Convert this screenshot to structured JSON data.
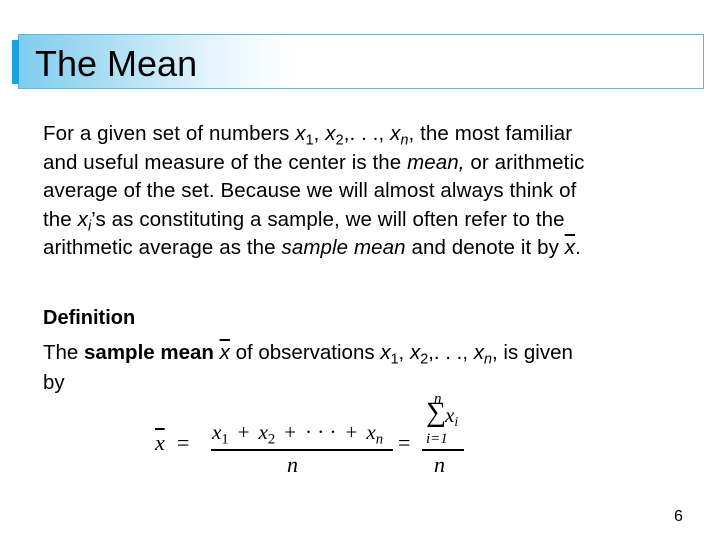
{
  "slide": {
    "title": "The Mean",
    "page_number": "6"
  },
  "intro": {
    "line1_a": "For a given set of numbers ",
    "line1_b": ", the most familiar",
    "line2_a": "and useful measure of the center is the ",
    "line2_em": "mean,",
    "line2_b": " or arithmetic",
    "line3": "average of the set. Because we will almost always think of",
    "line4_a": "the ",
    "line4_b": "’s as constituting a sample, we will often refer to the",
    "line5_a": "arithmetic average as the ",
    "line5_em": "sample mean",
    "line5_b": " and denote it by ",
    "line5_end": "."
  },
  "definition": {
    "heading": "Definition",
    "line1_a": "The ",
    "line1_bold": "sample mean",
    "line1_b": " of observations ",
    "line1_c": ", is given",
    "line2": "by"
  },
  "math": {
    "x": "x",
    "sub1": "1",
    "sub2": "2",
    "subn": "n",
    "subi": "i",
    "sep": ", ",
    "ellipsis": ". . .",
    "equals": "=",
    "plus": "+",
    "cdots": "· · ·",
    "n": "n",
    "sigma": "∑",
    "sum_lower": "i=1",
    "sum_upper": "n"
  }
}
